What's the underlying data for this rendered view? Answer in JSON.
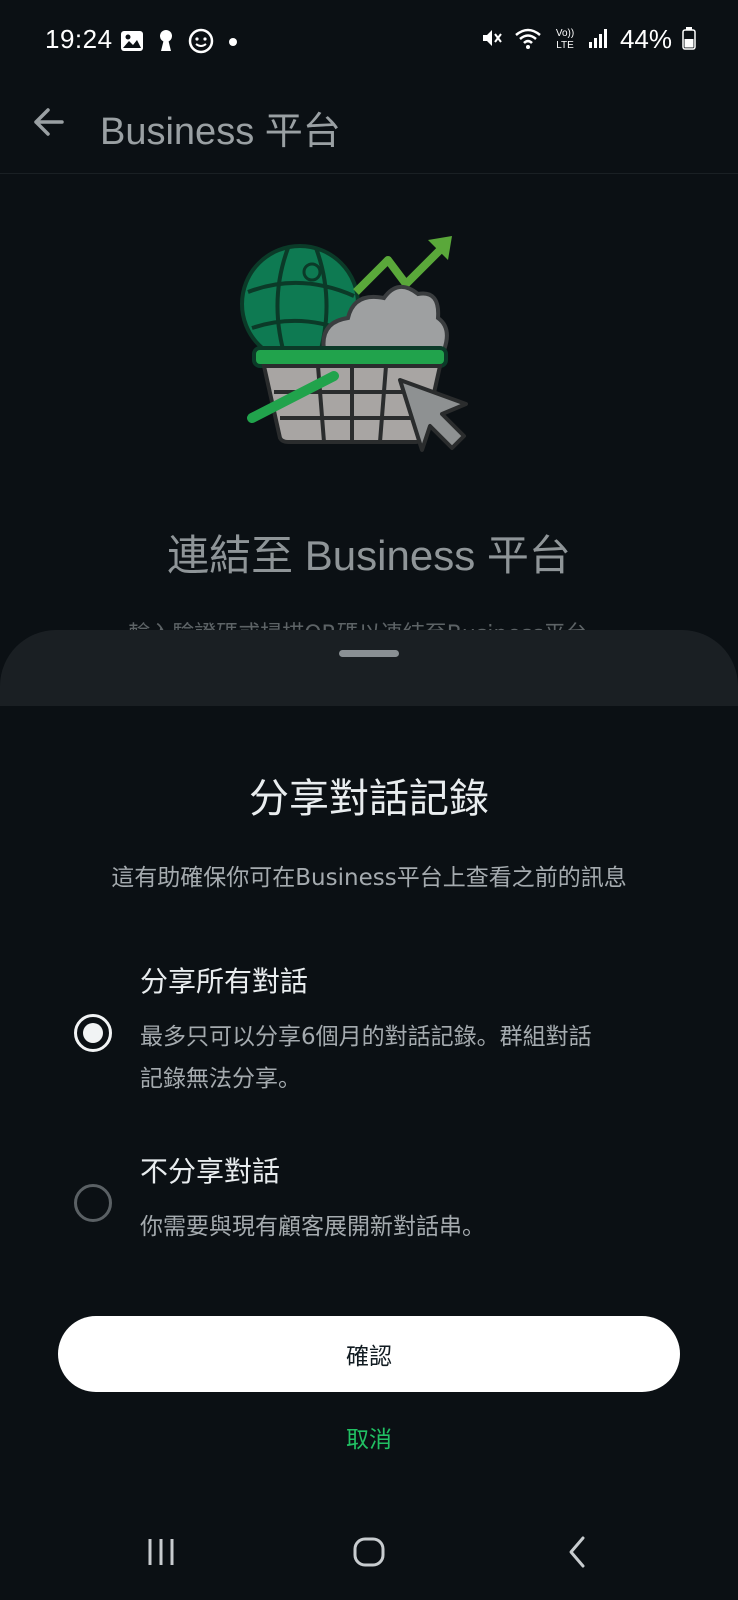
{
  "status_bar": {
    "time": "19:24",
    "battery_text": "44%",
    "left_icons": [
      "image-icon",
      "keyhole-icon",
      "smiley-icon",
      "dot-icon"
    ],
    "right_icons": [
      "mute-icon",
      "wifi-icon",
      "volte-icon",
      "signal-icon",
      "battery-icon"
    ],
    "volte_label_top": "Vo))",
    "volte_label_bottom": "LTE"
  },
  "header": {
    "title": "Business 平台",
    "back_icon": "arrow-left-icon"
  },
  "background": {
    "hero_title": "連結至 Business 平台",
    "hero_subtitle": "輸入驗證碼或掃描QR碼以連結至Business平台。"
  },
  "sheet": {
    "title": "分享對話記錄",
    "description": "這有助確保你可在Business平台上查看之前的訊息",
    "options": [
      {
        "title": "分享所有對話",
        "description": "最多只可以分享6個月的對話記錄。群組對話記錄無法分享。",
        "selected": true
      },
      {
        "title": "不分享對話",
        "description": "你需要與現有顧客展開新對話串。",
        "selected": false
      }
    ],
    "confirm_label": "確認",
    "cancel_label": "取消"
  },
  "nav_bar": {
    "icons": [
      "recents-icon",
      "home-icon",
      "back-icon"
    ]
  },
  "colors": {
    "background": "#0b1014",
    "sheet_header": "#1a1f23",
    "accent_green": "#21c063",
    "text_primary": "#e9edef",
    "text_secondary": "#a5abaf"
  }
}
